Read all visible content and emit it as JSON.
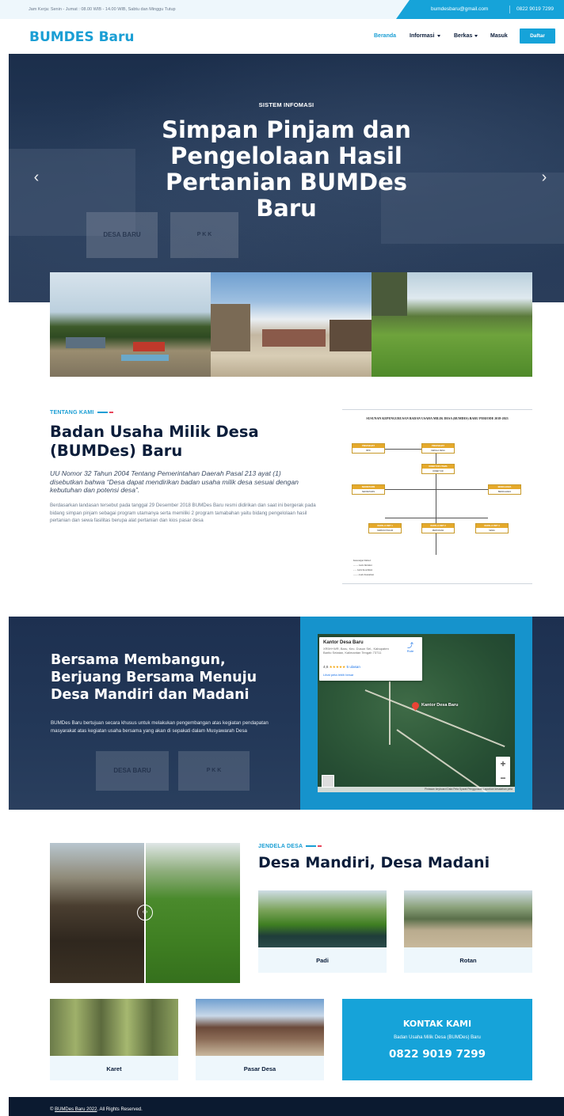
{
  "topbar": {
    "hours": "Jam Kerja: Senin - Jumat : 08.00 WIB - 14.00 WIB, Sabtu dan Minggu Tutup",
    "email": "bumdesbaru@gmail.com",
    "phone": "0822 9019 7299"
  },
  "navbar": {
    "brand": "BUMDES Baru",
    "items": [
      {
        "label": "Beranda",
        "active": true,
        "dropdown": false
      },
      {
        "label": "Informasi",
        "active": false,
        "dropdown": true
      },
      {
        "label": "Berkas",
        "active": false,
        "dropdown": true
      },
      {
        "label": "Masuk",
        "active": false,
        "dropdown": false
      }
    ],
    "register": "Daftar"
  },
  "hero": {
    "eyebrow": "SISTEM INFOMASI",
    "title": "Simpan Pinjam dan Pengelolaan Hasil Pertanian BUMDes Baru",
    "sign_left": "DESA BARU",
    "sign_right": "P K K",
    "prev_icon": "chevron-left-icon",
    "next_icon": "chevron-right-icon"
  },
  "about": {
    "eyebrow": "TENTANG KAMI",
    "title": "Badan Usaha Milik Desa (BUMDes) Baru",
    "quote": "UU Nomor 32 Tahun 2004 Tentang Pemerintahan Daerah Pasal 213 ayat (1) disebutkan bahwa “Desa dapat mendirikan badan usaha milik desa sesuai dengan kebutuhan dan potensi desa”.",
    "body": "Berdasarkan landasan tersebut pada tanggal 29 Desember 2018 BUMDes Baru resmi didirikan dan saat ini bergerak pada bidang simpan pinjam sebagai program utamanya serta memiliki 2 program tamabahan yaitu bidang pengelolaan hasil pertanian dan sewa fasilitas berupa alat pertanian dan kios pasar desa"
  },
  "orgchart": {
    "title": "SUSUNAN KEPENGURUSAN BADAN USAHA MILIK DESA (BUMDES) BARU PERIODE 2018-2023",
    "nodes": [
      {
        "role": "PENASEHAT",
        "name": "BPD"
      },
      {
        "role": "PENASEHAT",
        "name": "KEPALA DESA"
      },
      {
        "role": "DIREKTUR UTAMA",
        "name": "DIREKTUR"
      },
      {
        "role": "SEKRETARIS",
        "name": "SEKRETARIS"
      },
      {
        "role": "BENDAHARA",
        "name": "BENDAHARA"
      },
      {
        "role": "KEPALA UNIT 1",
        "name": "SIMPAN PINJAM"
      },
      {
        "role": "KEPALA UNIT 2",
        "name": "PERTANIAN"
      },
      {
        "role": "KEPALA UNIT 3",
        "name": "SEWA"
      }
    ],
    "legend": [
      "Keterangan Simbol:",
      "Garis Instruksi",
      "Garis Koordinasi",
      "Garis Konsultasi"
    ]
  },
  "mission": {
    "title": "Bersama Membangun, Berjuang Bersama Menuju Desa Mandiri dan Madani",
    "body": "BUMDes Baru bertujuan secara khusus untuk melakukan pengembangan atas kegiatan pendapatan masyarakat atas kegiatan usaha bersama yang akan di sepakati dalam Musyawarah Desa",
    "sign_left": "DESA BARU",
    "sign_right": "P K K"
  },
  "map": {
    "place": "Kantor Desa Baru",
    "address": "XR5H+WR, Baru, Kec. Dusun Sel., Kabupaten Barito Selatan, Kalimantan Tengah 73711",
    "rating": "4,6",
    "stars": "★★★★★",
    "reviews": "5 ulasan",
    "larger_map": "Lihat peta lebih besar",
    "route": "Rute",
    "pin_label": "Kantor Desa Baru",
    "zoom_in": "+",
    "zoom_out": "−",
    "footer": "Pintasan keyboard  Data Peta  Syarat Penggunaan  Laporkan kesalahan peta"
  },
  "window": {
    "eyebrow": "JENDELA DESA",
    "title": "Desa Mandiri, Desa Madani",
    "compare_handle": "‹ ›",
    "cards": [
      {
        "label": "Padi"
      },
      {
        "label": "Rotan"
      },
      {
        "label": "Karet"
      },
      {
        "label": "Pasar Desa"
      }
    ]
  },
  "kontak": {
    "title": "KONTAK KAMI",
    "subtitle": "Badan Usaha Milik Desa (BUMDes) Baru",
    "phone": "0822 9019 7299"
  },
  "footer": {
    "prefix": "© ",
    "link": "BUMDes Baru 2022",
    "suffix": ". All Rights Reserved."
  }
}
